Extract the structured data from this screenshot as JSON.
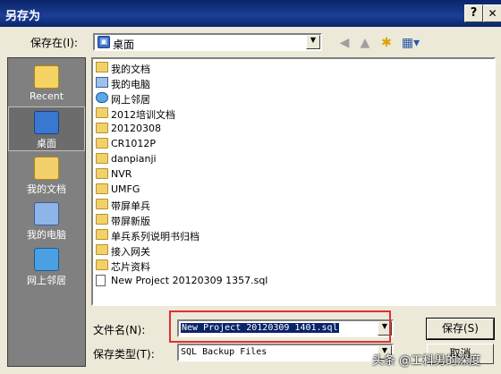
{
  "window": {
    "title": "另存为",
    "help_label": "?",
    "close_label": "✕"
  },
  "toolbar": {
    "save_in_label": "保存在(I):",
    "save_in_value": "桌面",
    "icons": [
      "back-icon",
      "up-folder-icon",
      "new-folder-icon",
      "view-menu-icon"
    ]
  },
  "places": [
    {
      "label": "Recent",
      "icon": "recent-icon"
    },
    {
      "label": "桌面",
      "icon": "desktop-icon",
      "active": true
    },
    {
      "label": "我的文档",
      "icon": "my-documents-icon"
    },
    {
      "label": "我的电脑",
      "icon": "my-computer-icon"
    },
    {
      "label": "网上邻居",
      "icon": "network-icon"
    }
  ],
  "files": [
    {
      "name": "我的文档",
      "icon": "my-documents-icon"
    },
    {
      "name": "我的电脑",
      "icon": "my-computer-icon"
    },
    {
      "name": "网上邻居",
      "icon": "network-icon"
    },
    {
      "name": "2012培训文档",
      "icon": "folder-icon"
    },
    {
      "name": "20120308",
      "icon": "folder-icon"
    },
    {
      "name": "CR1012P",
      "icon": "folder-icon"
    },
    {
      "name": "danpianji",
      "icon": "folder-icon"
    },
    {
      "name": "NVR",
      "icon": "folder-icon"
    },
    {
      "name": "UMFG",
      "icon": "folder-icon"
    },
    {
      "name": "带屏单兵",
      "icon": "folder-icon"
    },
    {
      "name": "带屏新版",
      "icon": "folder-icon"
    },
    {
      "name": "单兵系列说明书归档",
      "icon": "folder-icon"
    },
    {
      "name": "接入网关",
      "icon": "folder-icon"
    },
    {
      "name": "芯片资料",
      "icon": "folder-icon"
    },
    {
      "name": "New Project 20120309 1357.sql",
      "icon": "sql-file-icon"
    }
  ],
  "form": {
    "filename_label": "文件名(N):",
    "filename_value": "New Project 20120309 1401.sql",
    "filetype_label": "保存类型(T):",
    "filetype_value": "SQL Backup Files"
  },
  "buttons": {
    "save_label": "保存(S)",
    "cancel_label": "取消"
  },
  "watermark": "头条 @工科男的深度",
  "colors": {
    "titlebar": "#0a246a",
    "dialog": "#ece9d8",
    "places_bar": "#808080",
    "highlight_box": "#e03030"
  }
}
